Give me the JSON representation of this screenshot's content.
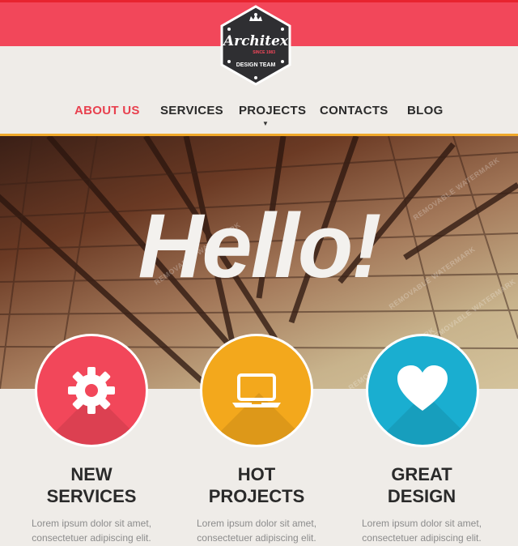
{
  "header": {
    "logo": {
      "name": "Architex",
      "since": "SINCE 1983",
      "tagline": "DESIGN TEAM"
    },
    "colors": {
      "brand_red": "#f2475a",
      "accent_orange": "#f0a92b"
    }
  },
  "nav": {
    "items": [
      {
        "label": "ABOUT US",
        "active": true
      },
      {
        "label": "SERVICES",
        "active": false
      },
      {
        "label": "PROJECTS",
        "active": false
      },
      {
        "label": "CONTACTS",
        "active": false
      },
      {
        "label": "BLOG",
        "active": false
      }
    ]
  },
  "hero": {
    "title": "Hello!",
    "watermark": "REMOVABLE WATERMARK"
  },
  "features": [
    {
      "line1": "NEW",
      "line2": "SERVICES",
      "text1": "Lorem ipsum dolor sit amet,",
      "text2": "consectetuer adipiscing elit.",
      "color": "#f2475a",
      "icon": "gear-icon"
    },
    {
      "line1": "HOT",
      "line2": "PROJECTS",
      "text1": "Lorem ipsum dolor sit amet,",
      "text2": "consectetuer adipiscing elit.",
      "color": "#f3a81c",
      "icon": "laptop-icon"
    },
    {
      "line1": "GREAT",
      "line2": "DESIGN",
      "text1": "Lorem ipsum dolor sit amet,",
      "text2": "consectetuer adipiscing elit.",
      "color": "#1aaed0",
      "icon": "heart-icon"
    }
  ]
}
